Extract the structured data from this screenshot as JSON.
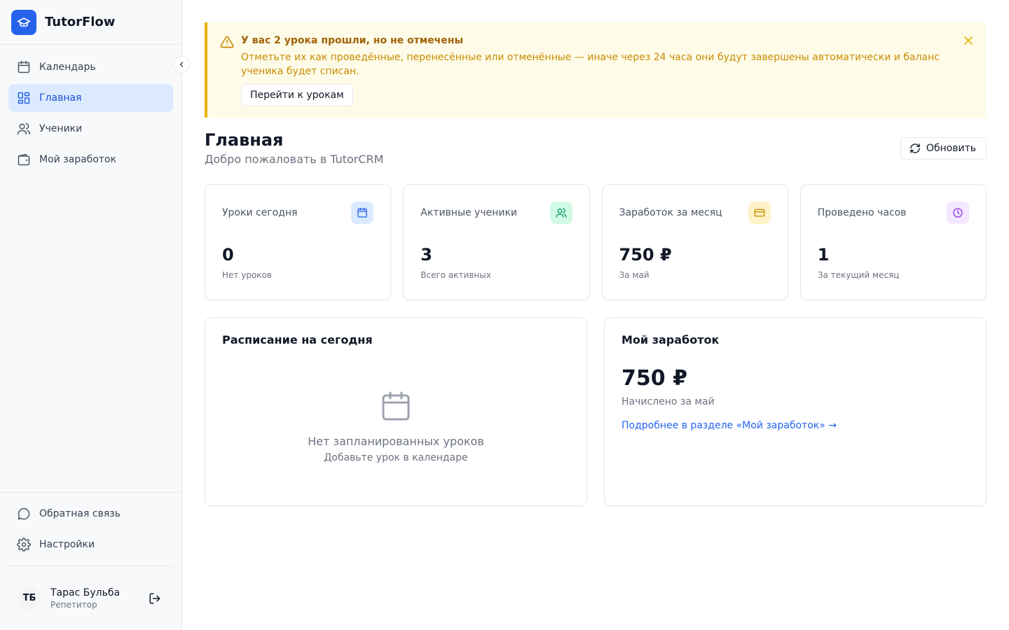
{
  "brand": {
    "name": "TutorFlow"
  },
  "sidebar": {
    "items": [
      {
        "label": "Календарь"
      },
      {
        "label": "Главная"
      },
      {
        "label": "Ученики"
      },
      {
        "label": "Мой заработок"
      }
    ],
    "bottom_items": [
      {
        "label": "Обратная связь"
      },
      {
        "label": "Настройки"
      }
    ],
    "user": {
      "initials": "ТБ",
      "name": "Тарас Бульба",
      "role": "Репетитор"
    }
  },
  "alert": {
    "title": "У вас 2 урока прошли, но не отмечены",
    "text": "Отметьте их как проведённые, перенесённые или отменённые — иначе через 24 часа они будут завершены автоматически и баланс ученика будет списан.",
    "button": "Перейти к урокам"
  },
  "page": {
    "title": "Главная",
    "subtitle": "Добро пожаловать в TutorCRM",
    "refresh": "Обновить"
  },
  "stats": [
    {
      "label": "Уроки сегодня",
      "value": "0",
      "hint": "Нет уроков",
      "color": "#2563eb",
      "bg": "#dbeafe"
    },
    {
      "label": "Активные ученики",
      "value": "3",
      "hint": "Всего активных",
      "color": "#059669",
      "bg": "#d1fae5"
    },
    {
      "label": "Заработок за месяц",
      "value": "750 ₽",
      "hint": "За май",
      "color": "#ca8a04",
      "bg": "#fef3c7"
    },
    {
      "label": "Проведено часов",
      "value": "1",
      "hint": "За текущий месяц",
      "color": "#9333ea",
      "bg": "#f3e8ff"
    }
  ],
  "schedule": {
    "title": "Расписание на сегодня",
    "empty_title": "Нет запланированных уроков",
    "empty_sub": "Добавьте урок в календаре"
  },
  "earnings": {
    "title": "Мой заработок",
    "value": "750 ₽",
    "sub": "Начислено за май",
    "link": "Подробнее в разделе «Мой заработок» →"
  },
  "colors": {
    "accent": "#2563eb",
    "warning": "#eab308",
    "warning_bg": "#fefce8"
  }
}
